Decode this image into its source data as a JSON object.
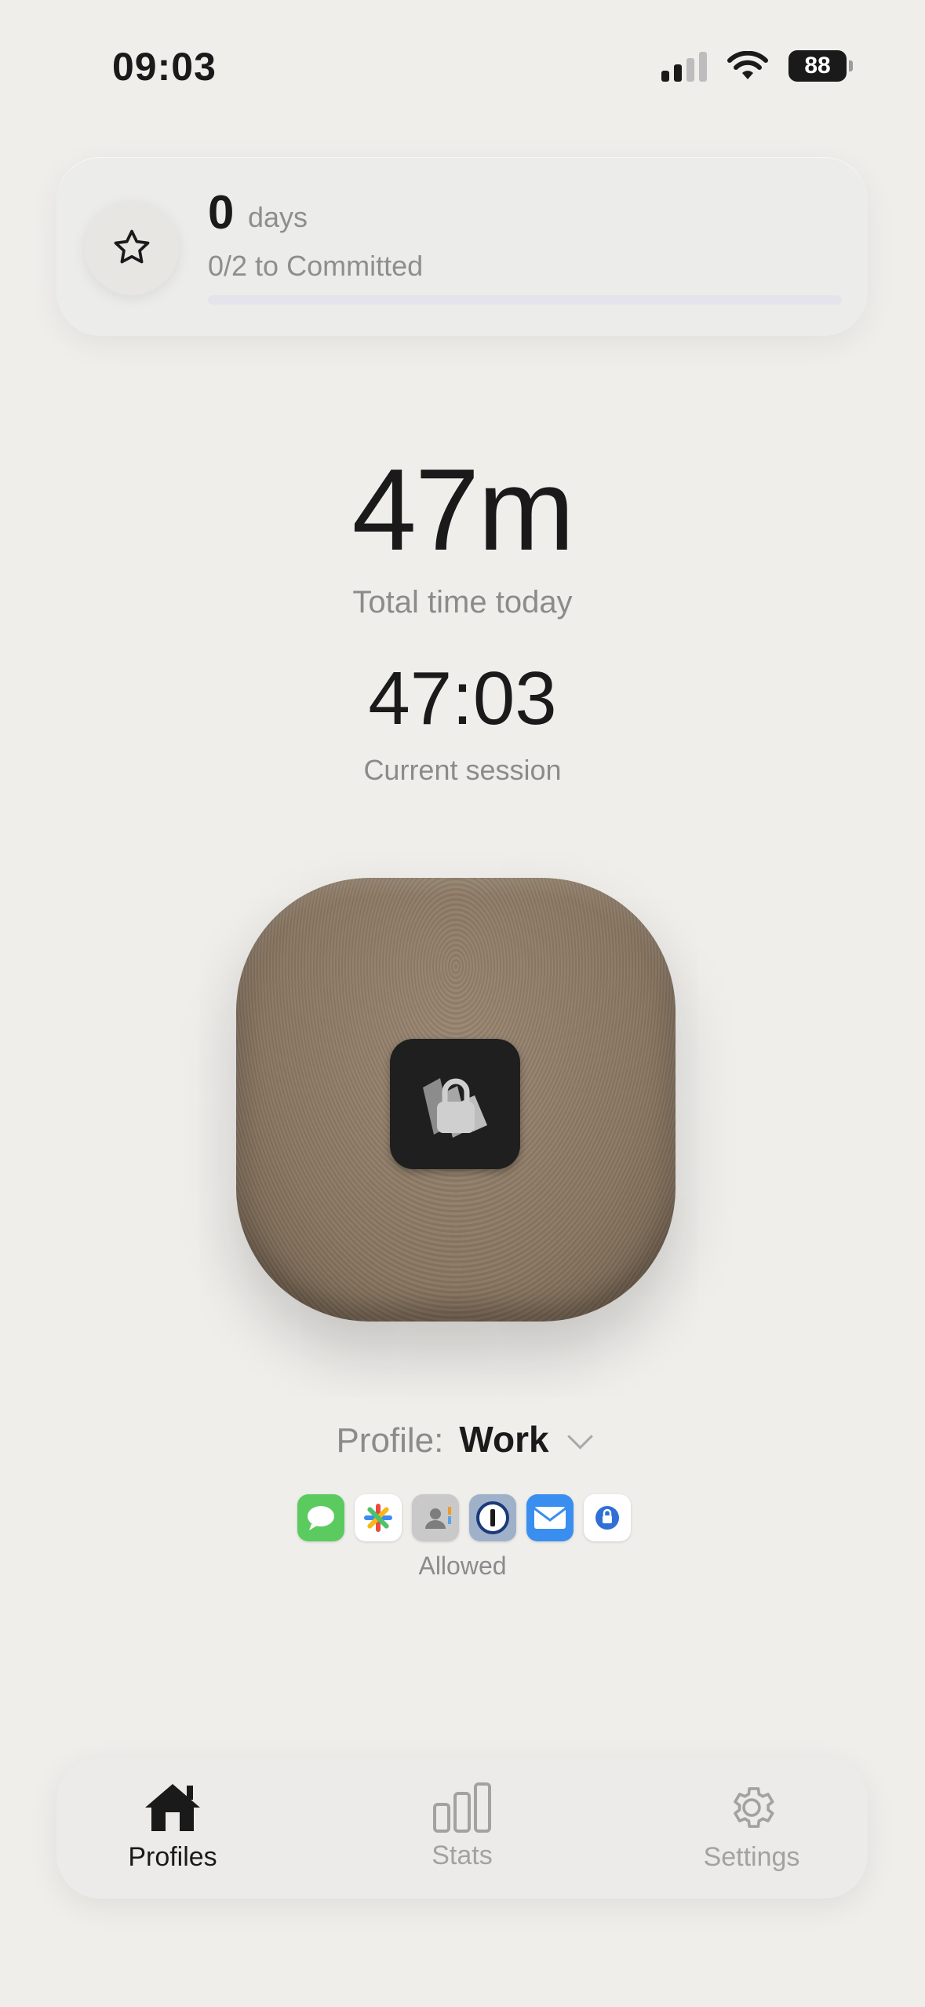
{
  "status_bar": {
    "time": "09:03",
    "battery": "88"
  },
  "streak": {
    "count": "0",
    "unit": "days",
    "subtitle": "0/2 to Committed",
    "progress": 0
  },
  "timers": {
    "total_value": "47m",
    "total_label": "Total time today",
    "session_value": "47:03",
    "session_label": "Current session"
  },
  "profile": {
    "label": "Profile:",
    "value": "Work"
  },
  "allowed": {
    "label": "Allowed",
    "apps": [
      "messages-app-icon",
      "photos-app-icon",
      "contacts-app-icon",
      "1password-app-icon",
      "mail-app-icon",
      "authenticator-app-icon"
    ]
  },
  "tabs": [
    {
      "label": "Profiles",
      "icon": "house-icon",
      "active": true
    },
    {
      "label": "Stats",
      "icon": "bar-chart-icon",
      "active": false
    },
    {
      "label": "Settings",
      "icon": "gear-icon",
      "active": false
    }
  ],
  "colors": {
    "background": "#efeeeb",
    "device": "#8a7762",
    "accent_text": "#1a1a1a",
    "muted_text": "#8b8b8b"
  }
}
